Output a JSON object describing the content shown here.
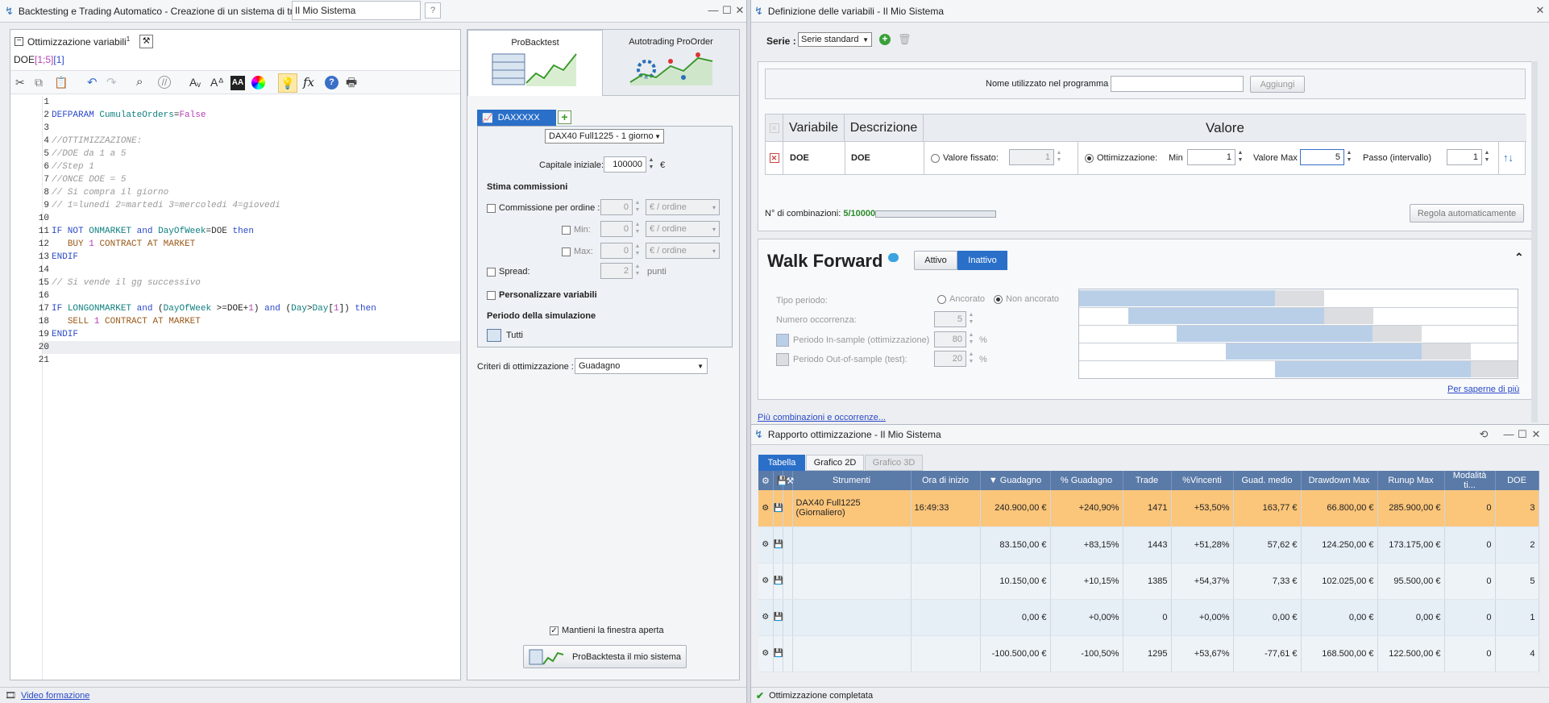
{
  "left_window": {
    "title": "Backtesting e Trading Automatico - Creazione di un sistema di trading",
    "system_name": "Il Mio Sistema"
  },
  "editor": {
    "section_title": "Ottimizzazione variabili",
    "section_sup": "1",
    "var_prefix": "DOE",
    "var_range": "[1;5]",
    "var_step": "[1]",
    "line_numbers": [
      "1",
      "2",
      "3",
      "4",
      "5",
      "6",
      "7",
      "8",
      "9",
      "10",
      "11",
      "12",
      "13",
      "14",
      "15",
      "16",
      "17",
      "18",
      "19",
      "20",
      "21"
    ]
  },
  "probacktest": {
    "tab_probacktest": "ProBacktest",
    "tab_autotrading": "Autotrading ProOrder",
    "instrument_tab": "DAXXXXX",
    "instrument_select": "DAX40 Full1225 - 1 giorno",
    "capital_label": "Capitale iniziale:",
    "capital_value": "100000",
    "capital_currency": "€",
    "commissions_title": "Stima commissioni",
    "commission_label": "Commissione per ordine :",
    "commission_value": "0",
    "commission_unit": "€ / ordine",
    "min_label": "Min:",
    "min_value": "0",
    "max_label": "Max:",
    "max_value": "0",
    "spread_label": "Spread:",
    "spread_value": "2",
    "spread_unit": "punti",
    "customize_label": "Personalizzare variabili",
    "period_title": "Periodo della simulazione",
    "period_value": "Tutti",
    "criteria_label": "Criteri di ottimizzazione :",
    "criteria_value": "Guadagno",
    "keep_open_label": "Mantieni la finestra aperta",
    "run_button": "ProBacktesta il mio sistema"
  },
  "footer_left": {
    "link": "Video formazione"
  },
  "variables_window": {
    "title": "Definizione delle variabili - Il Mio Sistema",
    "series_label": "Serie :",
    "series_value": "Serie standard",
    "name_label": "Nome utilizzato nel programma",
    "add_button": "Aggiungi",
    "col_variable": "Variabile",
    "col_description": "Descrizione",
    "col_value": "Valore",
    "var_name": "DOE",
    "var_desc": "DOE",
    "fixed_label": "Valore fissato:",
    "fixed_value": "1",
    "opt_label": "Ottimizzazione:",
    "min_label": "Min",
    "min_value": "1",
    "max_label": "Valore Max",
    "max_value": "5",
    "step_label": "Passo (intervallo)",
    "step_value": "1",
    "combinations_label": "N° di combinazioni:",
    "combinations_value": "5/10000",
    "auto_adjust_button": "Regola automaticamente"
  },
  "walk_forward": {
    "title": "Walk Forward",
    "active_label": "Attivo",
    "inactive_label": "Inattivo",
    "period_type_label": "Tipo periodo:",
    "anchored_label": "Ancorato",
    "not_anchored_label": "Non ancorato",
    "occurrences_label": "Numero occorrenza:",
    "occurrences_value": "5",
    "in_sample_label": "Periodo In-sample (ottimizzazione)",
    "in_sample_value": "80",
    "out_sample_label": "Periodo Out-of-sample (test):",
    "out_sample_value": "20",
    "percent": "%",
    "learn_more": "Per saperne di più",
    "more_link": "Più combinazioni e occorrenze..."
  },
  "report_window": {
    "title": "Rapporto ottimizzazione - Il Mio Sistema",
    "tab_table": "Tabella",
    "tab_2d": "Grafico 2D",
    "tab_3d": "Grafico 3D",
    "columns": [
      "Strumenti",
      "Ora di inizio",
      "Guadagno",
      "% Guadagno",
      "Trade",
      "%Vincenti",
      "Guad. medio",
      "Drawdown Max",
      "Runup Max",
      "Modalità ti...",
      "DOE"
    ],
    "rows": [
      [
        "DAX40 Full1225 (Giornaliero)",
        "16:49:33",
        "240.900,00 €",
        "+240,90%",
        "1471",
        "+53,50%",
        "163,77 €",
        "66.800,00 €",
        "285.900,00 €",
        "0",
        "3"
      ],
      [
        "",
        "",
        "83.150,00 €",
        "+83,15%",
        "1443",
        "+51,28%",
        "57,62 €",
        "124.250,00 €",
        "173.175,00 €",
        "0",
        "2"
      ],
      [
        "",
        "",
        "10.150,00 €",
        "+10,15%",
        "1385",
        "+54,37%",
        "7,33 €",
        "102.025,00 €",
        "95.500,00 €",
        "0",
        "5"
      ],
      [
        "",
        "",
        "0,00 €",
        "+0,00%",
        "0",
        "+0,00%",
        "0,00 €",
        "0,00 €",
        "0,00 €",
        "0",
        "1"
      ],
      [
        "",
        "",
        "-100.500,00 €",
        "-100,50%",
        "1295",
        "+53,67%",
        "-77,61 €",
        "168.500,00 €",
        "122.500,00 €",
        "0",
        "4"
      ]
    ],
    "status": "Ottimizzazione completata"
  }
}
